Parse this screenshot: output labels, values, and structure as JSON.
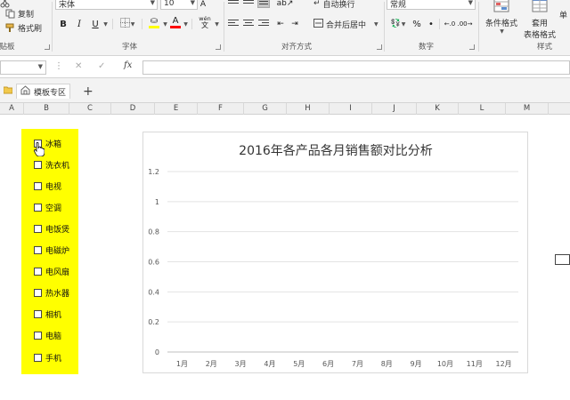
{
  "ribbon": {
    "clipboard": {
      "copy_label": "复制",
      "format_painter_label": "格式刷",
      "group_label": "剪贴板"
    },
    "font": {
      "font_name": "宋体",
      "font_size": "10",
      "bold": "B",
      "italic": "I",
      "underline": "U",
      "font_color_glyph": "A",
      "phonetic_label": "wén",
      "group_label": "字体"
    },
    "alignment": {
      "wrap_text_label": "自动换行",
      "merge_center_label": "合并后居中",
      "group_label": "对齐方式"
    },
    "number": {
      "format_value": "常规",
      "percent_glyph": "%",
      "comma_glyph": "•",
      "group_label": "数字"
    },
    "styles": {
      "conditional_format_label": "条件格式",
      "table_format_label_1": "套用",
      "table_format_label_2": "表格格式",
      "group_label": "样式",
      "cut_off_label": "单"
    }
  },
  "formula_bar": {
    "fx_label": "fx",
    "cancel_glyph": "✕",
    "enter_glyph": "✓",
    "more_glyph": "⋮"
  },
  "tabs": {
    "template_tab_label": "模板专区",
    "add_glyph": "+"
  },
  "columns": [
    "A",
    "B",
    "C",
    "D",
    "E",
    "F",
    "G",
    "H",
    "I",
    "J",
    "K",
    "L",
    "M"
  ],
  "checkboxes": [
    {
      "label": "冰箱"
    },
    {
      "label": "洗衣机"
    },
    {
      "label": "电视"
    },
    {
      "label": "空调"
    },
    {
      "label": "电饭煲"
    },
    {
      "label": "电磁炉"
    },
    {
      "label": "电风扇"
    },
    {
      "label": "热水器"
    },
    {
      "label": "相机"
    },
    {
      "label": "电脑"
    },
    {
      "label": "手机"
    }
  ],
  "chart_data": {
    "type": "line",
    "title": "2016年各产品各月销售额对比分析",
    "categories": [
      "1月",
      "2月",
      "3月",
      "4月",
      "5月",
      "6月",
      "7月",
      "8月",
      "9月",
      "10月",
      "11月",
      "12月"
    ],
    "yticks": [
      "0",
      "0.2",
      "0.4",
      "0.6",
      "0.8",
      "1",
      "1.2"
    ],
    "ylim": [
      0,
      1.2
    ],
    "series": [],
    "grid": true,
    "xlabel": "",
    "ylabel": ""
  },
  "colors": {
    "highlight": "#ffff00",
    "font_color_bar": "#ff0000",
    "fill_color_bar": "#ffff00"
  }
}
